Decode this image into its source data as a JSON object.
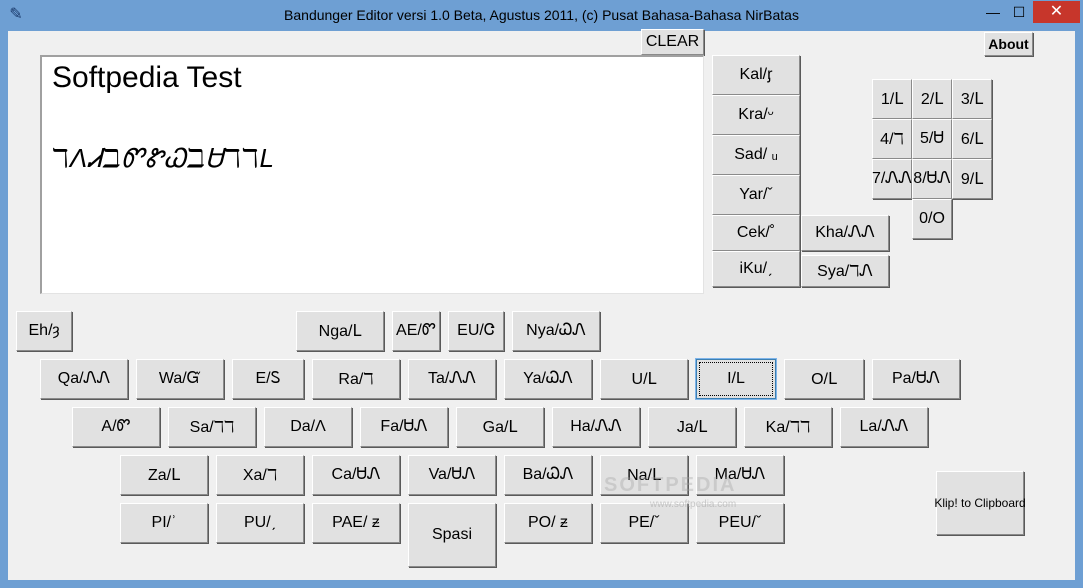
{
  "window": {
    "title": "Bandunger Editor versi 1.0 Beta, Agustus 2011, (c) Pusat Bahasa-Bahasa NirBatas",
    "icon": "app-icon",
    "minimize": "—",
    "maximize": "☐",
    "close": "✕"
  },
  "toolbar": {
    "clear_label": "CLEAR",
    "about_label": "About",
    "clipboard_label": "Klip! to Clipboard",
    "space_label": "Spasi"
  },
  "editor": {
    "line1": "Softpedia Test",
    "line2": "ℸɅᏗℶᏛᏑᏇℶᏌℸℸL"
  },
  "modifier_keys": [
    "Kal/ᶉ",
    "Kra/ᵕ",
    "Sad/ ᵤ",
    "Yar/ˇ",
    "Cek/˚",
    "iKu/ˏ",
    "Kha/ᏁᏁ",
    "Sya/ℸᏁ"
  ],
  "numbers": [
    "1/ᒪ",
    "2/ᒪ",
    "3/ᒪ",
    "4/ℸ",
    "5/Ꮜ",
    "6/ᒪ",
    "7/ᏁᏁ",
    "8/ᏌᏁ",
    "9/ᒪ",
    "0/O"
  ],
  "rows": {
    "row0": [
      "Eh/ȝ",
      "Nga/ᒪ",
      "AE/Ꮫ",
      "EU/Ꮳ",
      "Nya/ᏇᏁ"
    ],
    "row1": [
      "Qa/ᏁᏁ",
      "Wa/Ᏻ",
      "E/Ꮪ",
      "Ra/ℸ",
      "Ta/ᏁᏁ",
      "Ya/ᏇᏁ",
      "U/ᒪ",
      "I/L",
      "O/ᒪ",
      "Pa/ᏌᏁ"
    ],
    "row2": [
      "A/Ꮫ",
      "Sa/ℸℸ",
      "Da/Ʌ",
      "Fa/ᏌᏁ",
      "Ga/ᒪ",
      "Ha/ᏁᏁ",
      "Ja/ᒪ",
      "Ka/ℸℸ",
      "La/ᏁᏁ"
    ],
    "row3": [
      "Za/ᒪ",
      "Xa/ℸ",
      "Ca/ᏌᏁ",
      "Va/ᏌᏁ",
      "Ba/ᏇᏁ",
      "Na/ᒪ",
      "Ma/ᏌᏁ"
    ],
    "row4": [
      "PI/ʾ",
      "PU/ˏ",
      "PAE/ ᵶ",
      "PO/ ᵶ",
      "PE/ˇ",
      "PEU/ˇ"
    ]
  },
  "watermark": "SOFTPEDIA",
  "watermark_url": "www.softpedia.com",
  "colors": {
    "titlebar": "#6e9fd3",
    "close": "#c7362b",
    "face": "#e1e1e1",
    "client": "#f0f0f0"
  }
}
